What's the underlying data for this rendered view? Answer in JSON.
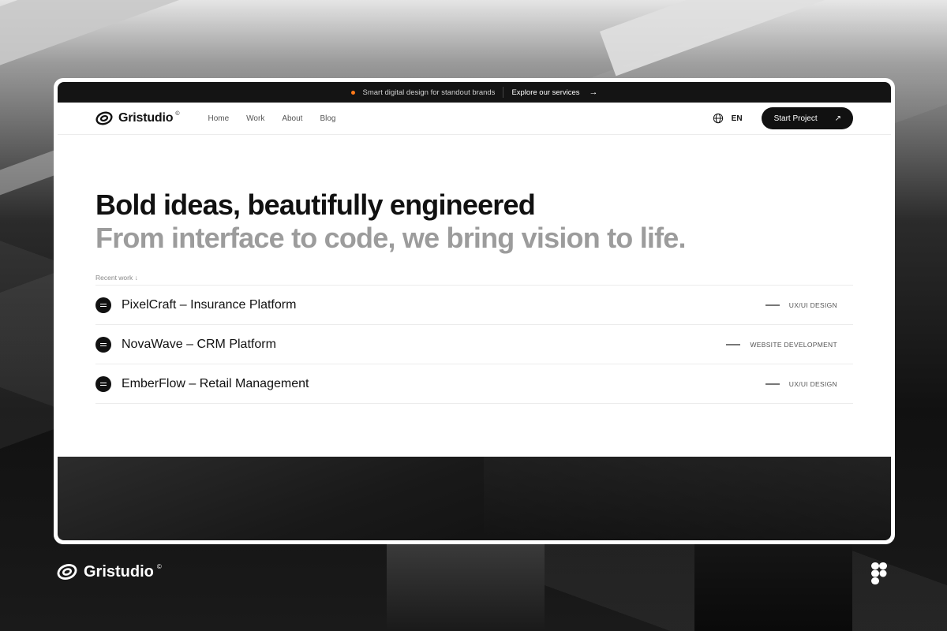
{
  "banner": {
    "tagline": "Smart digital design for standout brands",
    "link": "Explore our services",
    "arrow": "→"
  },
  "brand": {
    "name": "Gristudio",
    "mark": "©"
  },
  "nav": {
    "items": [
      "Home",
      "Work",
      "About",
      "Blog"
    ],
    "language": "EN",
    "cta": "Start Project",
    "cta_icon": "↗"
  },
  "hero": {
    "headline": "Bold ideas, beautifully engineered",
    "subheadline": "From interface to code, we bring vision to life."
  },
  "recent": {
    "label": "Recent work ↓",
    "items": [
      {
        "title": "PixelCraft – Insurance Platform",
        "category": "UX/UI DESIGN"
      },
      {
        "title": "NovaWave – CRM Platform",
        "category": "WEBSITE DEVELOPMENT"
      },
      {
        "title": "EmberFlow – Retail Management",
        "category": "UX/UI DESIGN"
      }
    ]
  },
  "icons": {
    "banner_dot": "dot-icon",
    "language": "globe-icon",
    "cta": "arrow-up-right-icon",
    "list_bullet": "menu-circle-icon",
    "footer_app": "figma-icon"
  },
  "colors": {
    "accent": "#ff7a1a",
    "dark": "#111111",
    "muted": "#9c9c9c",
    "background": "#ffffff"
  }
}
